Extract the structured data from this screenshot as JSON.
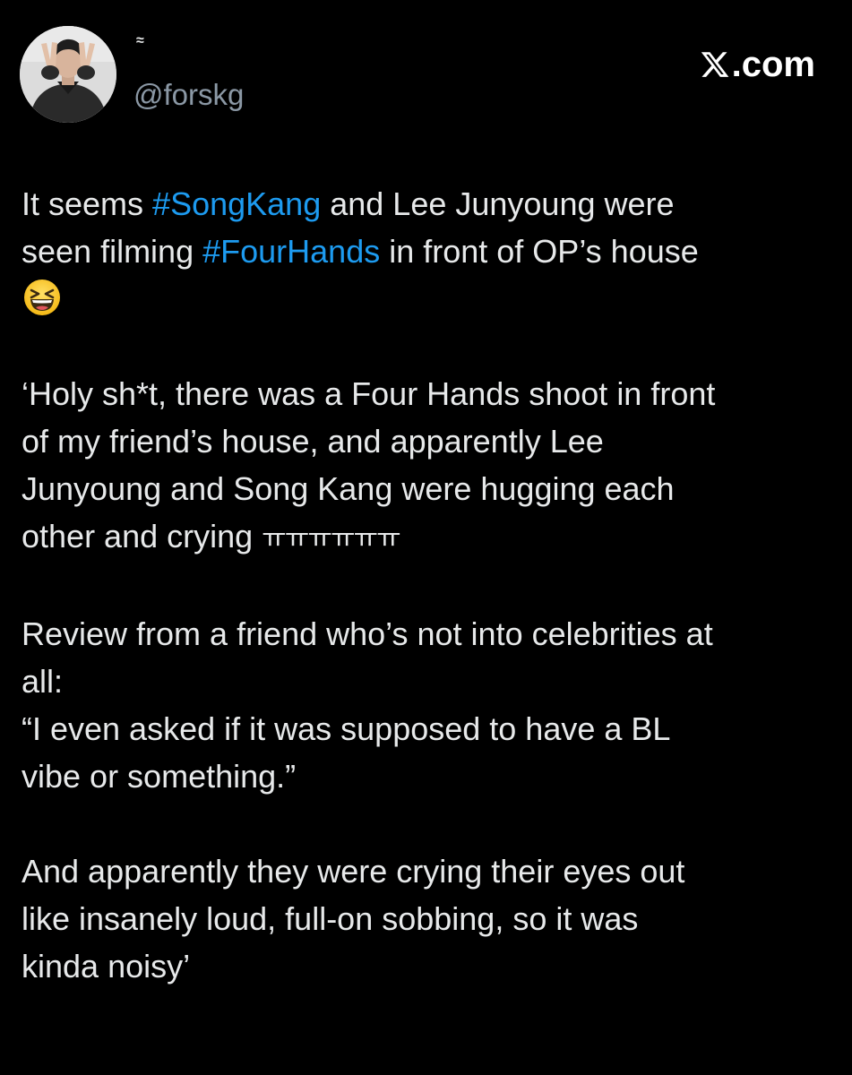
{
  "header": {
    "display_name": "≈",
    "handle": "@forskg",
    "brand": "X.com",
    "avatar_icon": "profile-photo"
  },
  "colors": {
    "background": "#000000",
    "text": "#e7e9ea",
    "muted": "#8b98a5",
    "hashtag": "#1d9bf0"
  },
  "tweet": {
    "p1": {
      "l1_a": "It seems ",
      "l1_tag": "#SongKang",
      "l1_b": " and Lee Junyoung were",
      "l2_a": "seen filming ",
      "l2_tag": "#FourHands",
      "l2_b": " in front of OP’s house",
      "emoji": "grinning-squinting-face"
    },
    "p2": {
      "l1": "‘Holy sh*t, there was a Four Hands shoot in front",
      "l2": "of my friend’s house, and apparently Lee",
      "l3": "Junyoung and Song Kang were hugging each",
      "l4_a": "other and crying ",
      "l4_kr": "ㅠㅠㅠㅠㅠㅠ"
    },
    "p3": {
      "l1": "Review from a friend who’s not into celebrities at",
      "l2": "all:",
      "l3": "“I even asked if it was supposed to have a BL",
      "l4": "vibe or something.”"
    },
    "p4": {
      "l1": "And apparently they were crying their eyes out",
      "l2": "like insanely loud, full-on sobbing, so it was",
      "l3": "kinda noisy’"
    }
  }
}
